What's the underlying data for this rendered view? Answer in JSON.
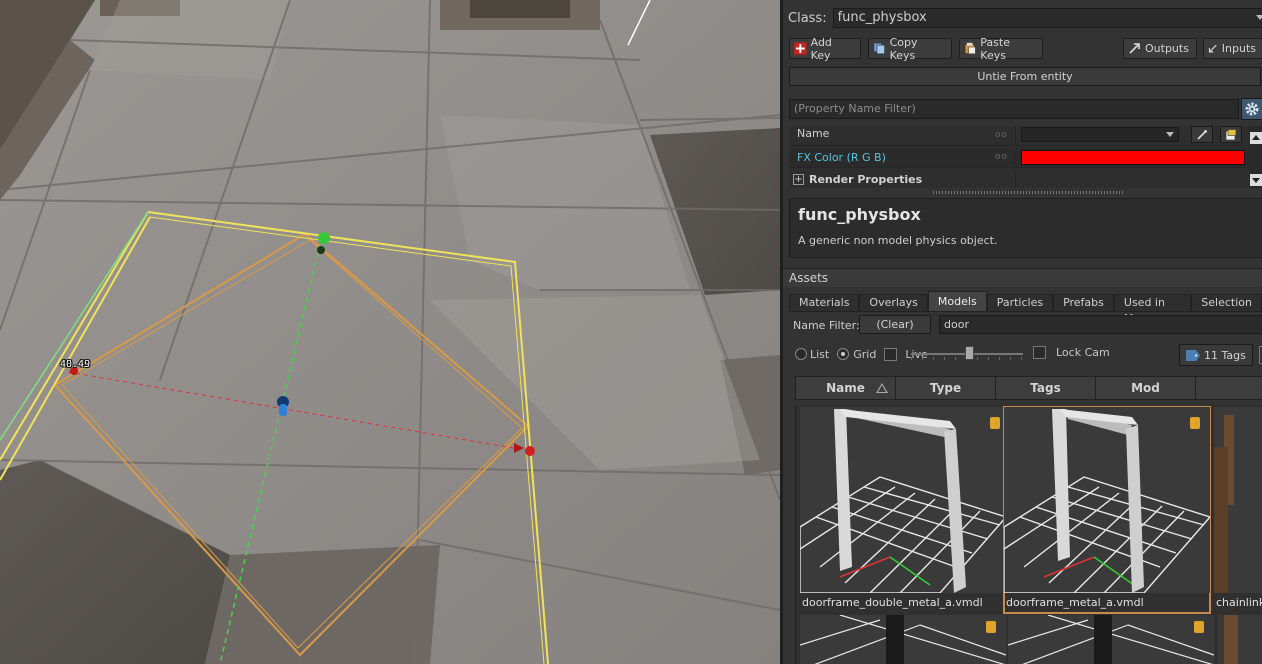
{
  "viewport": {
    "measurement": "40.49"
  },
  "panel": {
    "class_label": "Class:",
    "class_value": "func_physbox",
    "buttons": {
      "add_key": "Add Key",
      "copy_keys": "Copy Keys",
      "paste_keys": "Paste Keys",
      "outputs": "Outputs",
      "inputs": "Inputs"
    },
    "untie_label": "Untie From entity",
    "property_filter_placeholder": "(Property Name Filter)",
    "properties": [
      {
        "name": "Name",
        "value": ""
      },
      {
        "name": "FX Color (R G B)",
        "color": "#ff0000"
      }
    ],
    "section": "Render Properties",
    "help": {
      "title": "func_physbox",
      "description": "A generic non model physics object."
    }
  },
  "assets": {
    "header": "Assets",
    "tabs": [
      "Materials",
      "Overlays",
      "Models",
      "Particles",
      "Prefabs",
      "Used in Map",
      "Selection"
    ],
    "active_tab": "Models",
    "name_filter_label": "Name Filter:",
    "clear_label": "(Clear)",
    "filter_value": "door",
    "view_options": {
      "list": "List",
      "grid": "Grid",
      "selected": "Grid",
      "live": "Live",
      "lock_cam": "Lock Cam"
    },
    "tags_button": "11 Tags",
    "columns": [
      "Name",
      "Type",
      "Tags",
      "Mod"
    ],
    "items": [
      {
        "label": "doorframe_double_metal_a.vmdl",
        "selected": false
      },
      {
        "label": "doorframe_metal_a.vmdl",
        "selected": true
      },
      {
        "label": "chainlink_",
        "selected": false
      }
    ]
  },
  "colors": {
    "fx_color": "#ff0000",
    "selection_yellow": "#f2e25a",
    "selection_orange": "#d49a4a",
    "accent_blue": "#4a7fb5"
  }
}
